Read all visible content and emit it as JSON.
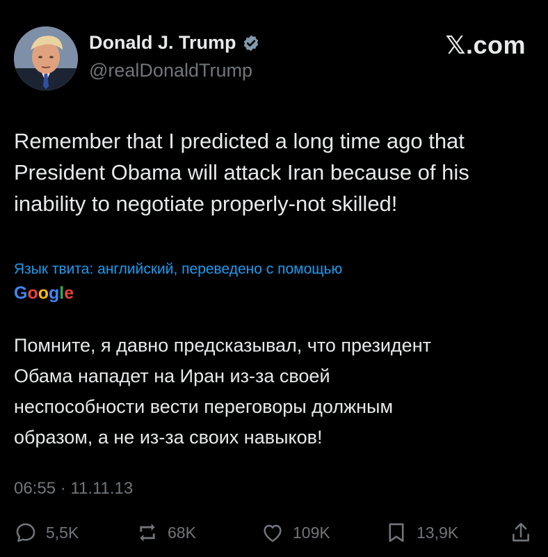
{
  "author": {
    "display_name": "Donald J. Trump",
    "handle": "@realDonaldTrump",
    "verified_icon": "verified-badge-icon"
  },
  "brand": "𝕏.com",
  "tweet": {
    "lines": [
      "Remember that I predicted a long time ago that",
      "President Obama will attack Iran because of his",
      "inability to negotiate properly-not skilled!"
    ]
  },
  "translation": {
    "note": "Язык твита: английский, переведено с помощью",
    "provider_letters": [
      "G",
      "o",
      "o",
      "g",
      "l",
      "e"
    ],
    "lines": [
      "Помните, я давно предсказывал, что президент",
      "Обама нападет на Иран из-за своей",
      "неспособности вести переговоры должным",
      "образом, а не из-за своих навыков!"
    ]
  },
  "timestamp": "06:55 · 11.11.13",
  "actions": {
    "replies": "5,5K",
    "reposts": "68K",
    "likes": "109K",
    "bookmarks": "13,9K"
  },
  "colors": {
    "background": "#000000",
    "text": "#e7e9ea",
    "muted": "#71767b",
    "link": "#1d9bf0",
    "verified": "#829aab"
  }
}
